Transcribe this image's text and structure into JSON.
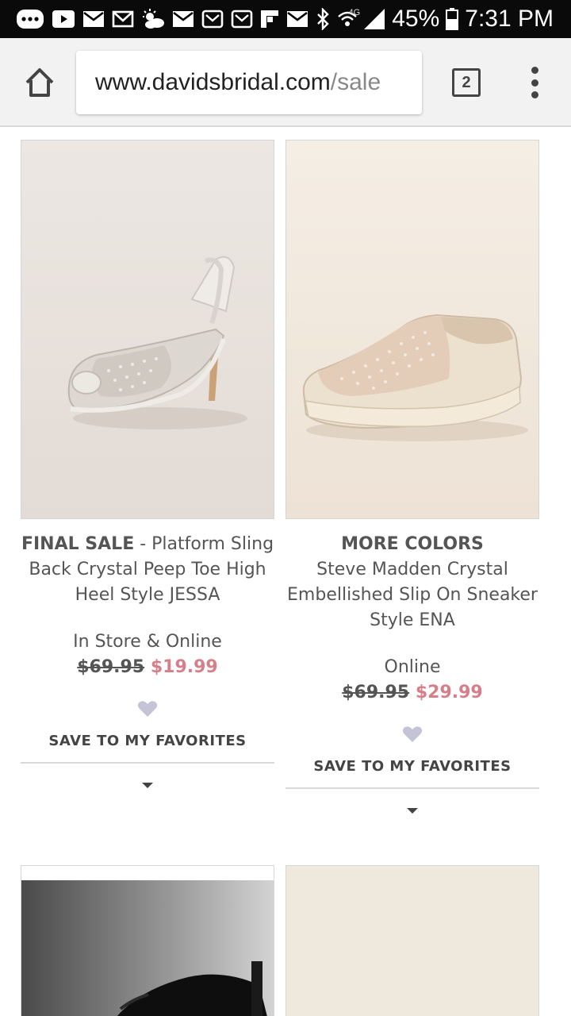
{
  "status_bar": {
    "battery": "45%",
    "time": "7:31 PM",
    "network": "4G"
  },
  "browser": {
    "url_host": "www.davidsbridal.com",
    "url_path": "/sale",
    "tab_count": "2"
  },
  "products": [
    {
      "flag": "FINAL SALE",
      "separator": " - ",
      "title_lines": [
        "Platform Sling",
        "Back Crystal Peep Toe High",
        "Heel Style JESSA"
      ],
      "availability": "In Store & Online",
      "old_price": "$69.95",
      "sale_price": "$19.99",
      "favorite_label": "SAVE TO MY FAVORITES",
      "image": "crystal-peep-toe-slingback-heel"
    },
    {
      "flag": "MORE COLORS",
      "separator": "",
      "title_lines": [
        "Steve Madden Crystal",
        "Embellished Slip On Sneaker",
        "Style ENA"
      ],
      "availability": "Online",
      "old_price": "$69.95",
      "sale_price": "$29.99",
      "favorite_label": "SAVE TO MY FAVORITES",
      "image": "crystal-slip-on-sneaker"
    },
    {
      "image": "black-shoe-partial"
    },
    {
      "image": "beige-background-partial"
    }
  ],
  "colors": {
    "sale_price": "#d57f8a",
    "heart": "#c4c4d6",
    "status_bar": "#0a0a0a"
  }
}
